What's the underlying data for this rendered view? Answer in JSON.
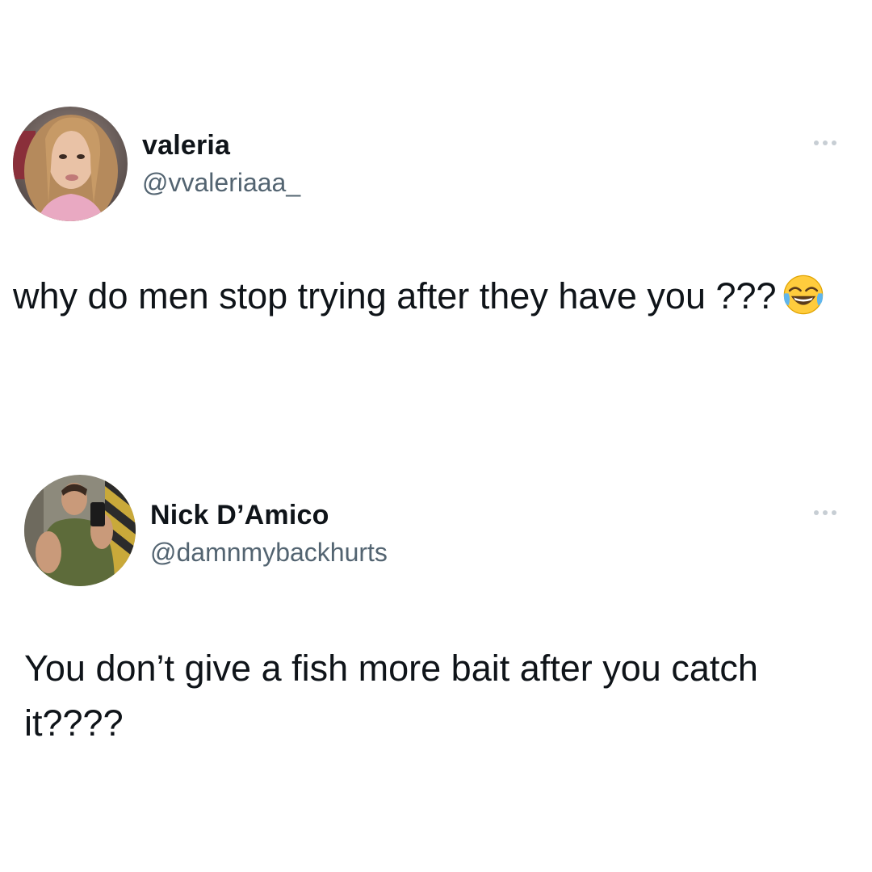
{
  "tweets": [
    {
      "display_name": "valeria",
      "handle": "@vvaleriaaa_",
      "text": "why do men stop trying after they have you ???",
      "emoji": "face-with-tears-of-joy-icon"
    },
    {
      "display_name": "Nick D’Amico",
      "handle": "@damnmybackhurts",
      "text": "You don’t give a fish more bait after you catch it????"
    }
  ],
  "colors": {
    "background": "#ffffff",
    "text_primary": "#0f1419",
    "text_secondary": "#536471",
    "more_dots": "#c7ced4"
  }
}
